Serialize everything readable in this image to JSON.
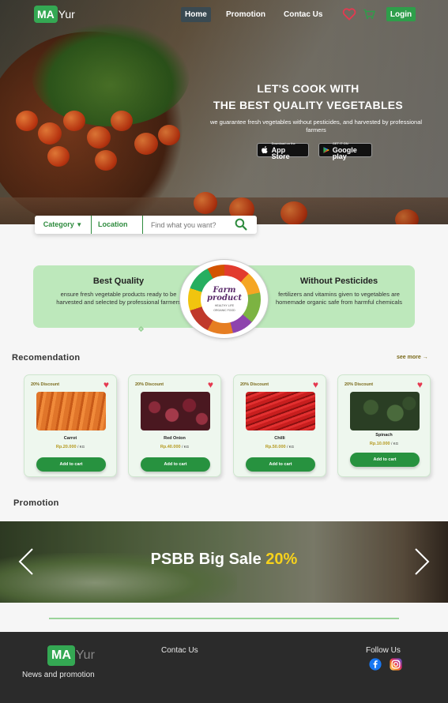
{
  "nav": {
    "logo_ma": "MA",
    "logo_yur": "Yur",
    "home": "Home",
    "promotion": "Promotion",
    "contact": "Contac Us",
    "login": "Login"
  },
  "hero": {
    "title_line1": "LET'S COOK WITH",
    "title_line2": "THE BEST QUALITY VEGETABLES",
    "subtitle": "we guarantee fresh vegetables without pesticides, and harvested by professional farmers",
    "appstore_small": "Download on the",
    "appstore_big": "App Store",
    "googleplay_small": "GET IT ON",
    "googleplay_big": "Google play"
  },
  "search": {
    "category": "Category",
    "location": "Location",
    "placeholder": "Find what you want?"
  },
  "features": {
    "left_title": "Best Quality",
    "left_text": "ensure fresh vegetable products ready to be harvested and selected by professional farmers",
    "right_title": "Without Pesticides",
    "right_text": "fertilizers and vitamins given to vegetables are homemade organic safe from harmful chemicals",
    "badge_title_1": "Farm",
    "badge_title_2": "product",
    "badge_sub_1": "HEALTHY LIFE",
    "badge_sub_2": "ORGANIC FOOD"
  },
  "recommendation": {
    "title": "Recomendation",
    "see_more": "see more",
    "products": [
      {
        "discount": "20% Discount",
        "name": "Carrot",
        "price": "Rp.20.000",
        "unit": "/ KG",
        "button": "Add to cart"
      },
      {
        "discount": "20% Discount",
        "name": "Red Onion",
        "price": "Rp.40.000",
        "unit": "/ KG",
        "button": "Add to cart"
      },
      {
        "discount": "20% Discount",
        "name": "Chilli",
        "price": "Rp.50.000",
        "unit": "/ KG",
        "button": "Add to cart"
      },
      {
        "discount": "20% Discount",
        "name": "Spinach",
        "price": "Rp.10.000",
        "unit": "/ KG",
        "button": "Add to cart"
      }
    ]
  },
  "promotion": {
    "title": "Promotion",
    "banner_text": "PSBB Big Sale",
    "banner_pct": "20%"
  },
  "footer": {
    "logo_ma": "MA",
    "logo_yur": "Yur",
    "news": "News and promotion",
    "contact": "Contac Us",
    "follow": "Follow Us"
  },
  "colors": {
    "brand_green": "#34a853",
    "feature_bg": "#bde8bb",
    "heart_red": "#e53950",
    "sale_yellow": "#f7d21c",
    "footer_bg": "#2b2b2b"
  }
}
